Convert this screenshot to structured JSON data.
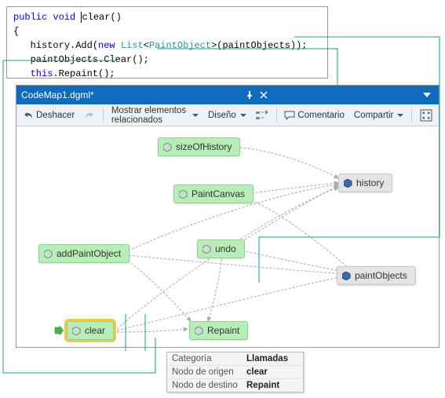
{
  "code": {
    "kw_public": "public",
    "kw_void": "void",
    "kw_new": "new",
    "kw_this": "this",
    "method_name": "clear",
    "parens": "()",
    "line_open": "{",
    "line_close": "}",
    "history_add_prefix": "history.Add(",
    "list_type": "List",
    "paint_obj_type": "PaintObject",
    "history_add_suffix": "(paintObjects));",
    "paint_clear": "paintObjects.Clear();",
    "this_repaint_call": ".Repaint();"
  },
  "window": {
    "title": "CodeMap1.dgml*"
  },
  "toolbar": {
    "undo": "Deshacer",
    "related": "Mostrar elementos relacionados",
    "layout": "Diseño",
    "comment": "Comentario",
    "share": "Compartir"
  },
  "nodes": {
    "sizeOfHistory": "sizeOfHistory",
    "paintCanvas": "PaintCanvas",
    "addPaintObject": "addPaintObject",
    "undo": "undo",
    "clear": "clear",
    "repaint": "Repaint",
    "history": "history",
    "paintObjects": "paintObjects"
  },
  "tooltip": {
    "cat_k": "Categoría",
    "cat_v": "Llamadas",
    "src_k": "Nodo de origen",
    "src_v": "clear",
    "dst_k": "Nodo de destino",
    "dst_v": "Repaint"
  },
  "chart_data": {
    "type": "graph",
    "nodes": [
      {
        "id": "sizeOfHistory",
        "kind": "method"
      },
      {
        "id": "PaintCanvas",
        "kind": "method"
      },
      {
        "id": "addPaintObject",
        "kind": "method"
      },
      {
        "id": "undo",
        "kind": "method"
      },
      {
        "id": "clear",
        "kind": "method",
        "selected": true
      },
      {
        "id": "Repaint",
        "kind": "method"
      },
      {
        "id": "history",
        "kind": "field"
      },
      {
        "id": "paintObjects",
        "kind": "field"
      }
    ],
    "edges": [
      {
        "from": "sizeOfHistory",
        "to": "history"
      },
      {
        "from": "PaintCanvas",
        "to": "history"
      },
      {
        "from": "PaintCanvas",
        "to": "paintObjects"
      },
      {
        "from": "addPaintObject",
        "to": "history"
      },
      {
        "from": "addPaintObject",
        "to": "paintObjects"
      },
      {
        "from": "addPaintObject",
        "to": "Repaint"
      },
      {
        "from": "undo",
        "to": "history"
      },
      {
        "from": "undo",
        "to": "paintObjects"
      },
      {
        "from": "undo",
        "to": "Repaint"
      },
      {
        "from": "clear",
        "to": "history"
      },
      {
        "from": "clear",
        "to": "paintObjects"
      },
      {
        "from": "clear",
        "to": "Repaint"
      }
    ]
  }
}
